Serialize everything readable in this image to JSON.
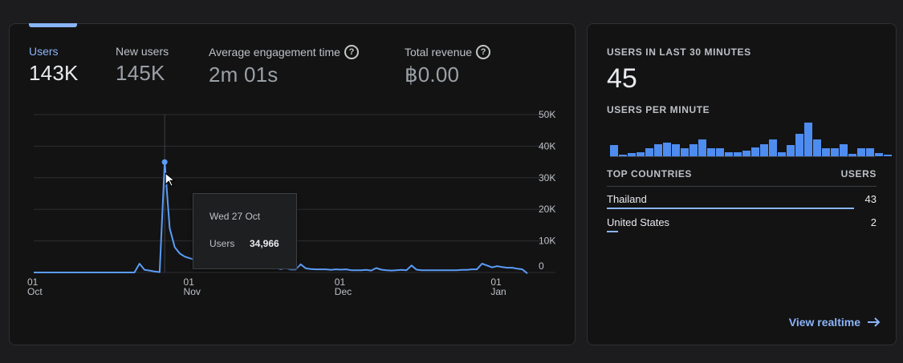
{
  "overview": {
    "metrics": [
      {
        "label": "Users",
        "value": "143K",
        "help": false,
        "active": true
      },
      {
        "label": "New users",
        "value": "145K",
        "help": false,
        "active": false
      },
      {
        "label": "Average engagement time",
        "value": "2m 01s",
        "help": true,
        "active": false
      },
      {
        "label": "Total revenue",
        "value": "฿0.00",
        "help": true,
        "active": false
      }
    ],
    "tooltip": {
      "date": "Wed 27 Oct",
      "label": "Users",
      "value": "34,966"
    }
  },
  "chart_data": {
    "type": "line",
    "ylabel": "",
    "ylim": [
      0,
      50000
    ],
    "yticks": [
      {
        "label": "50K",
        "value": 50000
      },
      {
        "label": "40K",
        "value": 40000
      },
      {
        "label": "30K",
        "value": 30000
      },
      {
        "label": "20K",
        "value": 20000
      },
      {
        "label": "10K",
        "value": 10000
      },
      {
        "label": "0",
        "value": 0
      }
    ],
    "xticks": [
      {
        "day": "01",
        "month": "Oct",
        "index": 0
      },
      {
        "day": "01",
        "month": "Nov",
        "index": 31
      },
      {
        "day": "01",
        "month": "Dec",
        "index": 61
      },
      {
        "day": "01",
        "month": "Jan",
        "index": 92
      }
    ],
    "highlight_index": 26,
    "series": [
      {
        "values": [
          0,
          0,
          0,
          0,
          0,
          0,
          0,
          0,
          0,
          0,
          0,
          0,
          0,
          0,
          0,
          0,
          0,
          0,
          0,
          0,
          0,
          2800,
          800,
          600,
          300,
          100,
          34966,
          14000,
          8000,
          6000,
          5000,
          4500,
          4000,
          3500,
          3200,
          3000,
          2700,
          2500,
          2500,
          2400,
          2200,
          2000,
          1900,
          1800,
          1700,
          1600,
          1500,
          2000,
          1600,
          1000,
          1400,
          900,
          900,
          2600,
          1300,
          1100,
          1000,
          1000,
          1000,
          800,
          1000,
          900,
          1000,
          700,
          700,
          700,
          800,
          600,
          1400,
          900,
          700,
          600,
          700,
          800,
          700,
          2200,
          900,
          700,
          700,
          700,
          700,
          700,
          700,
          700,
          700,
          800,
          800,
          1000,
          1000,
          2800,
          2200,
          1600,
          2000,
          1700,
          1500,
          1500,
          1200,
          1000,
          -300
        ]
      }
    ]
  },
  "realtime": {
    "title": "USERS IN LAST 30 MINUTES",
    "count": "45",
    "per_minute_label": "USERS PER MINUTE",
    "per_minute": [
      2,
      0.3,
      0.6,
      0.7,
      1.4,
      2.1,
      2.5,
      2.1,
      1.5,
      2.1,
      3.0,
      1.4,
      1.4,
      0.7,
      0.7,
      1.0,
      1.6,
      2.1,
      3.0,
      0.7,
      2.0,
      4.0,
      6.0,
      3.0,
      1.5,
      1.5,
      2.1,
      0.5,
      1.4,
      1.4,
      0.6,
      0.3
    ],
    "countries_header": "TOP COUNTRIES",
    "users_header": "USERS",
    "countries": [
      {
        "name": "Thailand",
        "value": "43",
        "share": 0.955
      },
      {
        "name": "United States",
        "value": "2",
        "share": 0.044
      }
    ],
    "link": "View realtime"
  },
  "colors": {
    "accent": "#8ab4f8",
    "line": "#5b9cf6",
    "bar": "#4e8cf0"
  }
}
